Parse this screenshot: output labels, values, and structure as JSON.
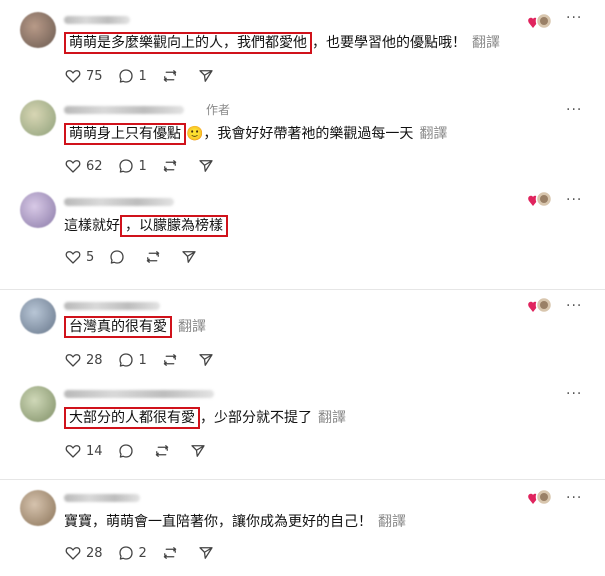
{
  "more_label": "···",
  "comments": [
    {
      "segments": [
        {
          "text": "萌萌是多麼樂觀向上的人，我們都愛他",
          "hl": true
        },
        {
          "text": "，也要學習他的優點哦！",
          "hl": false
        }
      ],
      "translate": "翻譯",
      "likes": "75",
      "replies": "1",
      "author_tag": "",
      "liked_by_author": true
    },
    {
      "segments": [
        {
          "text": "萌萌身上只有優點",
          "hl": true
        },
        {
          "text": "🙂，我會好好帶著祂的樂觀過每一天",
          "hl": false
        }
      ],
      "translate": "翻譯",
      "likes": "62",
      "replies": "1",
      "author_tag": "作者",
      "liked_by_author": false
    },
    {
      "segments": [
        {
          "text": "這樣就好",
          "hl": false
        },
        {
          "text": "，以朦朦為榜樣",
          "hl": true
        }
      ],
      "translate": "",
      "likes": "5",
      "replies": "",
      "author_tag": "",
      "liked_by_author": true
    },
    {
      "segments": [
        {
          "text": "台灣真的很有愛",
          "hl": true
        }
      ],
      "translate": "翻譯",
      "likes": "28",
      "replies": "1",
      "author_tag": "",
      "liked_by_author": true
    },
    {
      "segments": [
        {
          "text": "大部分的人都很有愛",
          "hl": true
        },
        {
          "text": "，少部分就不提了",
          "hl": false
        }
      ],
      "translate": "翻譯",
      "likes": "14",
      "replies": "",
      "author_tag": "",
      "liked_by_author": false
    },
    {
      "segments": [
        {
          "text": "寶寶，萌萌會一直陪著你，讓你成為更好的自己！",
          "hl": false
        }
      ],
      "translate": "翻譯",
      "likes": "28",
      "replies": "2",
      "author_tag": "",
      "liked_by_author": true
    }
  ],
  "colors": {
    "highlight_border": "#d0121b",
    "heart": "#e0245e"
  }
}
